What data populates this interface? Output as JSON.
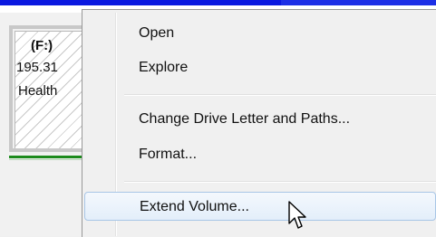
{
  "volume": {
    "name": "(F:)",
    "size": "195.31",
    "status": "Health"
  },
  "context_menu": {
    "items": [
      {
        "label": "Open"
      },
      {
        "label": "Explore"
      },
      {
        "label": "Change Drive Letter and Paths..."
      },
      {
        "label": "Format..."
      },
      {
        "label": "Extend Volume..."
      }
    ],
    "highlighted_item": "Extend Volume..."
  },
  "colors": {
    "title_bar_blue": "#0a18e0",
    "healthy_green": "#1c8a1c",
    "highlight_border": "#a8c6e6",
    "highlight_fill": "#e3eefa",
    "menu_background": "#f0f0f0"
  },
  "icons": {
    "cursor": "arrow-pointer-icon"
  }
}
